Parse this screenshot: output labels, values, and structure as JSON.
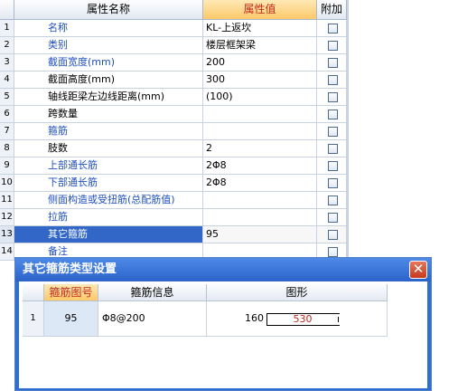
{
  "grid": {
    "headers": {
      "name": "属性名称",
      "value": "属性值",
      "extra": "附加"
    },
    "rows": [
      {
        "num": "1",
        "name": "名称",
        "value": "KL-上返坎"
      },
      {
        "num": "2",
        "name": "类别",
        "value": "楼层框架梁"
      },
      {
        "num": "3",
        "name": "截面宽度(mm)",
        "value": "200"
      },
      {
        "num": "4",
        "name": "截面高度(mm)",
        "value": "300"
      },
      {
        "num": "5",
        "name": "轴线距梁左边线距离(mm)",
        "value": "(100)"
      },
      {
        "num": "6",
        "name": "跨数量",
        "value": ""
      },
      {
        "num": "7",
        "name": "箍筋",
        "value": ""
      },
      {
        "num": "8",
        "name": "肢数",
        "value": "2"
      },
      {
        "num": "9",
        "name": "上部通长筋",
        "value": "2Φ8"
      },
      {
        "num": "10",
        "name": "下部通长筋",
        "value": "2Φ8"
      },
      {
        "num": "11",
        "name": "侧面构造或受扭筋(总配筋值)",
        "value": ""
      },
      {
        "num": "12",
        "name": "拉筋",
        "value": ""
      },
      {
        "num": "13",
        "name": "其它箍筋",
        "value": "95"
      },
      {
        "num": "14",
        "name": "备注",
        "value": ""
      }
    ]
  },
  "dialog": {
    "title": "其它箍筋类型设置",
    "close": "✕",
    "table": {
      "headers": {
        "code": "箍筋图号",
        "info": "箍筋信息",
        "shape": "图形"
      },
      "rows": [
        {
          "num": "1",
          "code": "95",
          "info": "Φ8@200",
          "dim_left": "160",
          "dim_box": "530"
        }
      ]
    }
  },
  "colors": {
    "accent": "#3266c7",
    "highlight_header": "#fbc96a",
    "title_bar": "#2b63c8"
  }
}
